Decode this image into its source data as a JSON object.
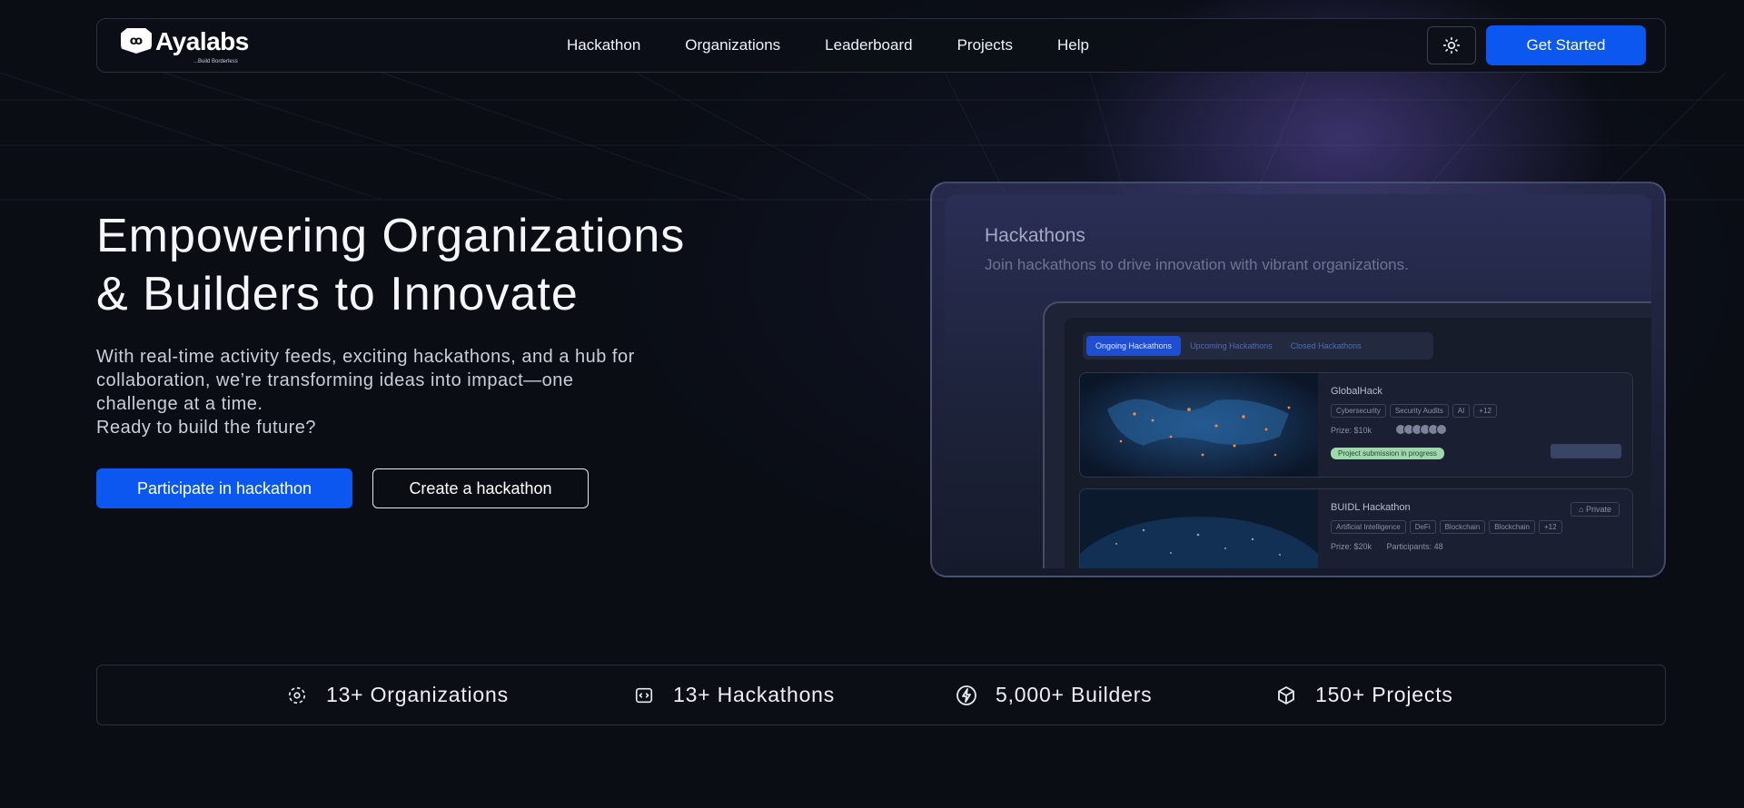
{
  "brand": {
    "name": "Ayalabs",
    "tagline": "...Build Borderless"
  },
  "nav": {
    "links": [
      "Hackathon",
      "Organizations",
      "Leaderboard",
      "Projects",
      "Help"
    ],
    "theme_icon": "sun-icon",
    "cta": "Get Started"
  },
  "hero": {
    "title_line1": "Empowering Organizations",
    "title_line2": "& Builders to Innovate",
    "desc_line1": "With real-time activity feeds, exciting hackathons, and a hub for",
    "desc_line2": "collaboration, we’re transforming ideas into impact—one",
    "desc_line3": "challenge at a time.",
    "desc_line4": "Ready to build the future?",
    "primary_button": "Participate in hackathon",
    "secondary_button": "Create a hackathon"
  },
  "preview": {
    "title": "Hackathons",
    "subtitle": "Join hackathons to drive innovation with vibrant organizations.",
    "tabs": [
      "Ongoing Hackathons",
      "Upcoming Hackathons",
      "Closed Hackathons"
    ],
    "cards": [
      {
        "name": "GlobalHack",
        "tags": [
          "Cybersecurity",
          "Security Audits",
          "AI",
          "+12"
        ],
        "prize": "Prize: $10k",
        "status": "Project submission in progress"
      },
      {
        "name": "BUIDL Hackathon",
        "visibility": "Private",
        "tags": [
          "Artificial Intelligence",
          "DeFi",
          "Blockchain",
          "Blockchain",
          "+12"
        ],
        "prize": "Prize: $20k",
        "participants": "Participants: 48"
      }
    ]
  },
  "stats": [
    {
      "icon": "organizations-icon",
      "label": "13+ Organizations"
    },
    {
      "icon": "code-window-icon",
      "label": "13+ Hackathons"
    },
    {
      "icon": "lightning-icon",
      "label": "5,000+ Builders"
    },
    {
      "icon": "cube-icon",
      "label": "150+ Projects"
    }
  ],
  "colors": {
    "accent": "#0b57f0",
    "background": "#0a0d14",
    "border": "#2a3140"
  }
}
